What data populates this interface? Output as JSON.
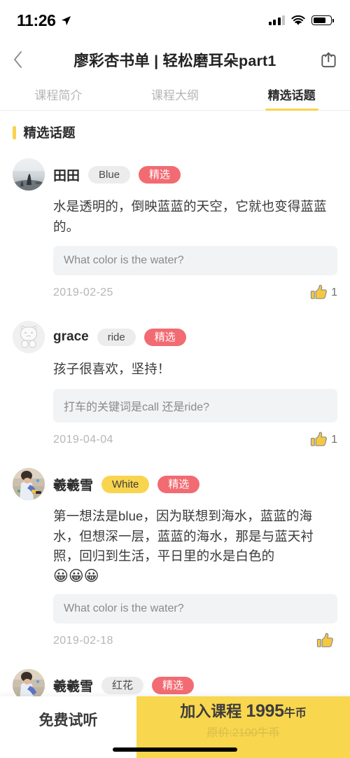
{
  "statusbar": {
    "time": "11:26",
    "location_icon": "location-arrow-icon",
    "signal_icon": "cellular-signal-icon",
    "wifi_icon": "wifi-icon",
    "battery_icon": "battery-icon",
    "battery_level": 72
  },
  "header": {
    "back_icon": "chevron-left-icon",
    "title": "廖彩杏书单 | 轻松磨耳朵part1",
    "share_icon": "share-icon"
  },
  "tabs": [
    {
      "label": "课程简介",
      "active": false
    },
    {
      "label": "课程大纲",
      "active": false
    },
    {
      "label": "精选话题",
      "active": true
    }
  ],
  "section": {
    "title": "精选话题",
    "accent_color": "#fbd24e"
  },
  "colors": {
    "accent_yellow": "#fbd24e",
    "cta_yellow": "#f8d64e",
    "badge_red": "#f26b72",
    "pill_grey": "#ececec",
    "pill_yellow": "#f9d44e",
    "qbox_grey": "#f2f3f5",
    "thumb_yellow": "#f3c842"
  },
  "comments": [
    {
      "avatar": "seascape-photo-avatar",
      "username": "田田",
      "tag": "Blue",
      "tag_style": "grey",
      "badge": "精选",
      "text": "水是透明的，倒映蓝蓝的天空，它就也变得蓝蓝的。",
      "emoji": "",
      "question": "What color is the water?",
      "date": "2019-02-25",
      "like_icon": "thumbs-up-icon",
      "like_count": "1",
      "liked": true
    },
    {
      "avatar": "cartoon-bear-avatar",
      "username": "grace",
      "tag": "ride",
      "tag_style": "grey",
      "badge": "精选",
      "text": "孩子很喜欢，坚持！",
      "emoji": "",
      "question": "打车的关键词是call 还是ride?",
      "date": "2019-04-04",
      "like_icon": "thumbs-up-icon",
      "like_count": "1",
      "liked": true
    },
    {
      "avatar": "child-playing-photo-avatar",
      "username": "羲羲雪",
      "tag": "White",
      "tag_style": "yellow",
      "badge": "精选",
      "text": "第一想法是blue，因为联想到海水，蓝蓝的海水，但想深一层，蓝蓝的海水，那是与蓝天衬照，回归到生活，平日里的水是白色的",
      "emoji": "😀😀😀",
      "question": "What color is the water?",
      "date": "2019-02-18",
      "like_icon": "thumbs-up-icon",
      "like_count": "",
      "liked": true
    },
    {
      "avatar": "child-playing-photo-avatar",
      "username": "羲羲雪",
      "tag": "红花",
      "tag_style": "grey",
      "badge": "精选",
      "text": "",
      "emoji": "",
      "question": "",
      "date": "",
      "like_icon": "thumbs-up-icon",
      "like_count": "",
      "liked": false
    }
  ],
  "bottombar": {
    "trial_label": "免费试听",
    "cta_label": "加入课程",
    "cta_price": "1995",
    "cta_unit": "牛币",
    "cta_original": "原价:2100牛币"
  }
}
